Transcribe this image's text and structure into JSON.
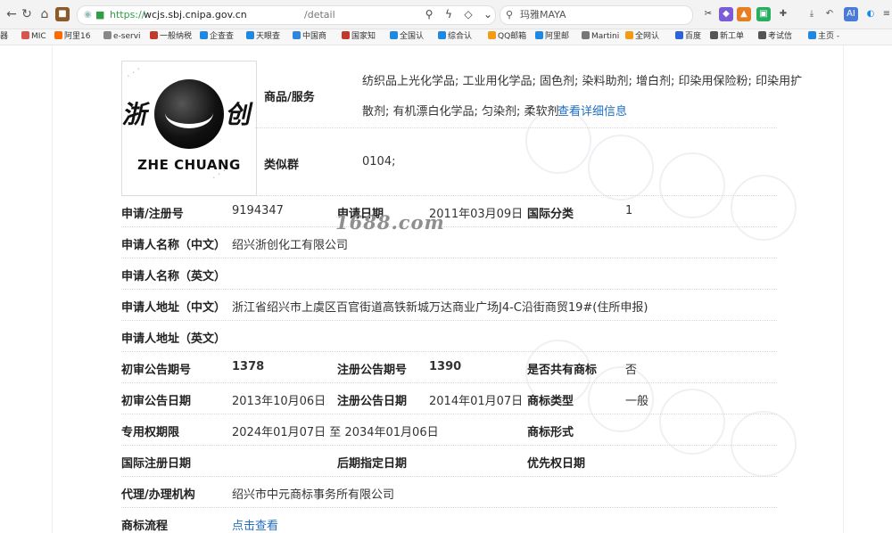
{
  "browser": {
    "url_scheme": "https://",
    "url_host": "wcjs.sbj.cnipa.gov.cn",
    "url_path": "/detail",
    "search_text": "玛雅MAYA"
  },
  "bookmarks": [
    {
      "label": "MIC",
      "color": "#d9534f"
    },
    {
      "label": "阿里16",
      "color": "#ff6a00"
    },
    {
      "label": "e-servi",
      "color": "#888888"
    },
    {
      "label": "一般纳税",
      "color": "#c0392b"
    },
    {
      "label": "企查查",
      "color": "#1e88e5"
    },
    {
      "label": "天眼查",
      "color": "#1e88e5"
    },
    {
      "label": "中国商",
      "color": "#2e86de"
    },
    {
      "label": "国家知",
      "color": "#c0392b"
    },
    {
      "label": "全国认",
      "color": "#1e88e5"
    },
    {
      "label": "综合认",
      "color": "#1e88e5"
    },
    {
      "label": "QQ邮箱",
      "color": "#f39c12"
    },
    {
      "label": "阿里邮",
      "color": "#1e88e5"
    },
    {
      "label": "Martini",
      "color": "#777777"
    },
    {
      "label": "全网认",
      "color": "#f39c12"
    },
    {
      "label": "百度",
      "color": "#2e62d9"
    },
    {
      "label": "新工单",
      "color": "#555555"
    },
    {
      "label": "考试信",
      "color": "#555555"
    },
    {
      "label": "主页 -",
      "color": "#1e88e5"
    }
  ],
  "watermark_text": "1688.com",
  "logo": {
    "cn_left": "浙",
    "cn_right": "创",
    "en": "ZHE CHUANG"
  },
  "goods": {
    "label": "商品/服务",
    "line1": "纺织品上光化学品; 工业用化学品; 固色剂; 染料助剂; 增白剂; 印染用保险粉; 印染用扩",
    "line2": "散剂; 有机漂白化学品; 匀染剂; 柔软剂",
    "detail_link": "查看详细信息"
  },
  "similar_group": {
    "label": "类似群",
    "value": "0104;"
  },
  "fields": {
    "reg_no_label": "申请/注册号",
    "reg_no": "9194347",
    "app_date_label": "申请日期",
    "app_date": "2011年03月09日",
    "intl_class_label": "国际分类",
    "intl_class": "1",
    "applicant_cn_label": "申请人名称（中文）",
    "applicant_cn": "绍兴浙创化工有限公司",
    "applicant_en_label": "申请人名称（英文）",
    "applicant_en": "",
    "address_cn_label": "申请人地址（中文）",
    "address_cn": "浙江省绍兴市上虞区百官街道高铁新城万达商业广场J4-C沿街商贸19#(住所申报)",
    "address_en_label": "申请人地址（英文）",
    "address_en": "",
    "prelim_no_label": "初审公告期号",
    "prelim_no": "1378",
    "reg_pub_no_label": "注册公告期号",
    "reg_pub_no": "1390",
    "shared_label": "是否共有商标",
    "shared": "否",
    "prelim_date_label": "初审公告日期",
    "prelim_date": "2013年10月06日",
    "reg_pub_date_label": "注册公告日期",
    "reg_pub_date": "2014年01月07日",
    "tm_type_label": "商标类型",
    "tm_type": "一般",
    "term_label": "专用权期限",
    "term": "2024年01月07日 至 2034年01月06日",
    "tm_form_label": "商标形式",
    "tm_form": "",
    "intl_reg_date_label": "国际注册日期",
    "later_date_label": "后期指定日期",
    "priority_date_label": "优先权日期",
    "agent_label": "代理/办理机构",
    "agent": "绍兴市中元商标事务所有限公司",
    "flow_label": "商标流程",
    "flow_link": "点击查看"
  }
}
